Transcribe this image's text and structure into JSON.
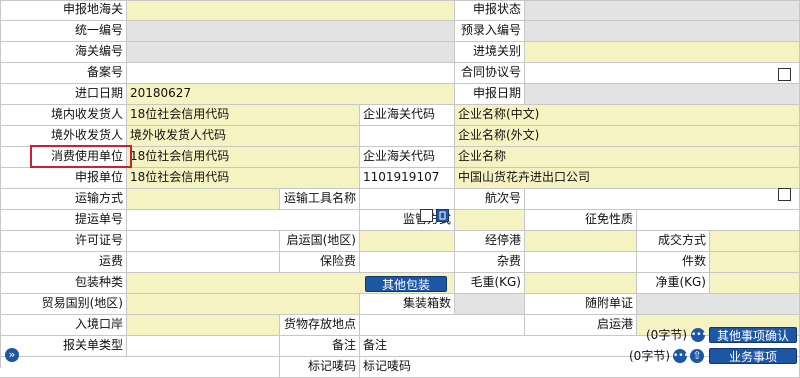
{
  "rows": [
    [
      {
        "t": "lbl",
        "text": "申报地海关"
      },
      {
        "t": "yel",
        "text": ""
      },
      {
        "t": "lbl",
        "text": "申报状态"
      },
      {
        "t": "gry",
        "text": ""
      }
    ],
    [
      {
        "t": "lbl",
        "text": "统一编号"
      },
      {
        "t": "gry",
        "text": ""
      },
      {
        "t": "lbl",
        "text": "预录入编号"
      },
      {
        "t": "gry",
        "text": ""
      }
    ],
    [
      {
        "t": "lbl",
        "text": "海关编号"
      },
      {
        "t": "gry",
        "text": ""
      },
      {
        "t": "lbl",
        "text": "进境关别"
      },
      {
        "t": "yel",
        "text": ""
      }
    ],
    [
      {
        "t": "lbl",
        "text": "备案号"
      },
      {
        "t": "val",
        "text": ""
      },
      {
        "t": "lbl",
        "text": "合同协议号"
      },
      {
        "t": "val",
        "text": ""
      }
    ],
    [
      {
        "t": "lbl",
        "text": "进口日期"
      },
      {
        "t": "yel",
        "text": "20180627"
      },
      {
        "t": "lbl",
        "text": "申报日期"
      },
      {
        "t": "gry",
        "text": ""
      }
    ],
    [
      {
        "t": "lbl",
        "text": "境内收发货人"
      },
      {
        "t": "yel",
        "text": "18位社会信用代码"
      },
      {
        "t": "val",
        "text": "企业海关代码"
      },
      {
        "t": "yel",
        "text": "企业名称(中文)"
      }
    ],
    [
      {
        "t": "lbl",
        "text": "境外收发货人"
      },
      {
        "t": "yel",
        "text": "境外收发货人代码"
      },
      {
        "t": "val",
        "text": ""
      },
      {
        "t": "yel",
        "text": "企业名称(外文)"
      }
    ],
    [
      {
        "t": "lbl",
        "text": "消费使用单位"
      },
      {
        "t": "yel",
        "text": "18位社会信用代码"
      },
      {
        "t": "val",
        "text": "企业海关代码"
      },
      {
        "t": "yel",
        "text": "企业名称"
      }
    ],
    [
      {
        "t": "lbl",
        "text": "申报单位"
      },
      {
        "t": "yel",
        "text": "18位社会信用代码"
      },
      {
        "t": "val",
        "text": "1101919107"
      },
      {
        "t": "yel",
        "text": "中国山货花卉进出口公司"
      }
    ],
    [
      {
        "t": "lbl",
        "text": "运输方式"
      },
      {
        "t": "yel",
        "text": ""
      },
      {
        "t": "lbl",
        "text": "运输工具名称"
      },
      {
        "t": "val",
        "text": ""
      },
      {
        "t": "lbl",
        "text": "航次号"
      },
      {
        "t": "val",
        "text": ""
      }
    ],
    [
      {
        "t": "lbl",
        "text": "提运单号"
      },
      {
        "t": "val",
        "text": ""
      },
      {
        "t": "lbl",
        "text": "监管方式"
      },
      {
        "t": "yel",
        "text": ""
      },
      {
        "t": "lbl",
        "text": "征免性质"
      },
      {
        "t": "val",
        "text": ""
      }
    ],
    [
      {
        "t": "lbl",
        "text": "许可证号"
      },
      {
        "t": "val",
        "text": ""
      },
      {
        "t": "lbl",
        "text": "启运国(地区)"
      },
      {
        "t": "yel",
        "text": ""
      },
      {
        "t": "lbl",
        "text": "经停港"
      },
      {
        "t": "yel",
        "text": ""
      },
      {
        "t": "lbl",
        "text": "成交方式"
      },
      {
        "t": "yel",
        "text": ""
      }
    ],
    [
      {
        "t": "lbl",
        "text": "运费"
      },
      {
        "t": "val",
        "text": ""
      },
      {
        "t": "lbl",
        "text": "保险费"
      },
      {
        "t": "val",
        "text": ""
      },
      {
        "t": "lbl",
        "text": "杂费"
      },
      {
        "t": "val",
        "text": ""
      },
      {
        "t": "lbl",
        "text": "件数"
      },
      {
        "t": "yel",
        "text": ""
      }
    ],
    [
      {
        "t": "lbl",
        "text": "包装种类"
      },
      {
        "t": "yel",
        "text": ""
      },
      {
        "t": "lbl",
        "text": "毛重(KG)"
      },
      {
        "t": "yel",
        "text": ""
      },
      {
        "t": "lbl",
        "text": "净重(KG)"
      },
      {
        "t": "yel",
        "text": ""
      }
    ],
    [
      {
        "t": "lbl",
        "text": "贸易国别(地区)"
      },
      {
        "t": "yel",
        "text": ""
      },
      {
        "t": "lbl",
        "text": "集装箱数"
      },
      {
        "t": "gry",
        "text": ""
      },
      {
        "t": "lbl",
        "text": "随附单证"
      },
      {
        "t": "gry",
        "text": ""
      }
    ],
    [
      {
        "t": "lbl",
        "text": "入境口岸"
      },
      {
        "t": "yel",
        "text": ""
      },
      {
        "t": "lbl",
        "text": "货物存放地点"
      },
      {
        "t": "val",
        "text": ""
      },
      {
        "t": "lbl",
        "text": "启运港"
      },
      {
        "t": "yel",
        "text": ""
      }
    ],
    [
      {
        "t": "lbl",
        "text": "报关单类型"
      },
      {
        "t": "val",
        "text": ""
      },
      {
        "t": "lbl",
        "text": "备注"
      },
      {
        "t": "txt",
        "text": "备注"
      }
    ],
    [
      {
        "t": "val",
        "text": ""
      },
      {
        "t": "lbl",
        "text": "标记唛码"
      },
      {
        "t": "txt",
        "text": "标记唛码"
      }
    ]
  ],
  "remarks_count": "(0字节)",
  "marks_count": "(0字节)",
  "buttons": {
    "other_packaging": "其他包装",
    "other_items_confirm": "其他事项确认",
    "business_items": "业务事项"
  },
  "icons": {
    "expand": "»",
    "more": "•••",
    "upload": "⇧"
  },
  "colors": {
    "required_field": "#f6f3c2",
    "readonly_field": "#e3e3e3",
    "button": "#1e56a6",
    "highlight_box": "#d02030"
  }
}
